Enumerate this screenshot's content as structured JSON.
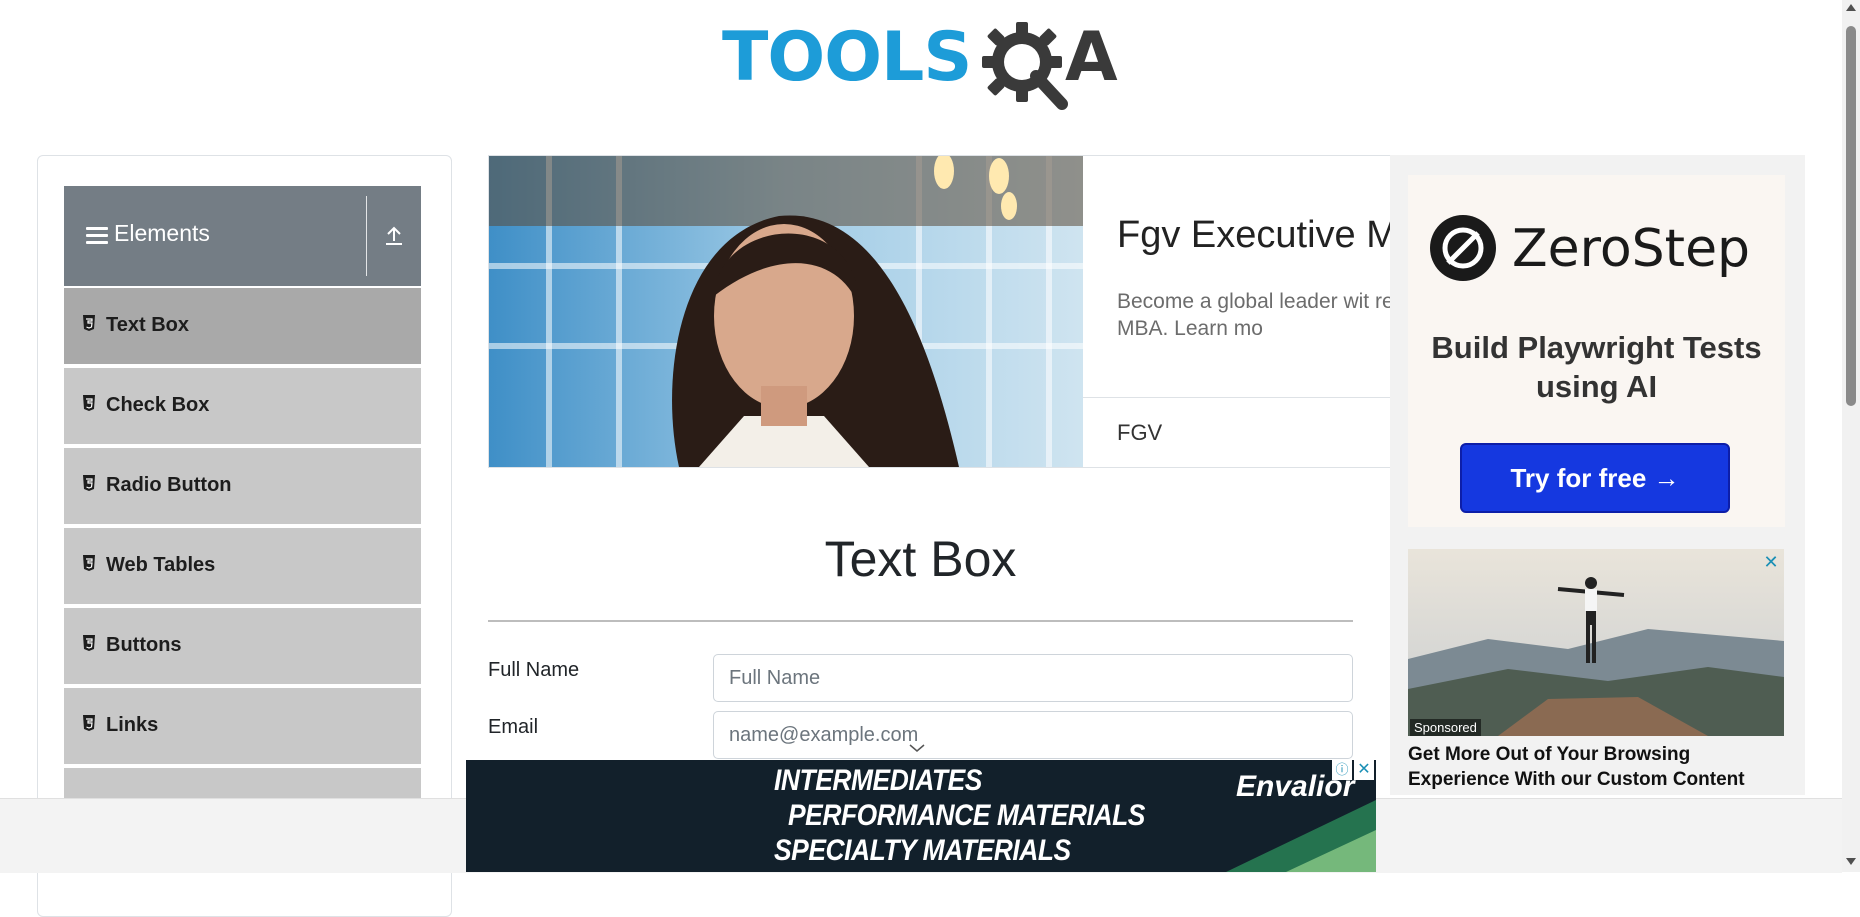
{
  "header": {
    "logo_text_left": "TOOLS",
    "logo_text_right": "A",
    "logo_alt": "TOOLSQA"
  },
  "sidebar": {
    "group_title": "Elements",
    "items": [
      {
        "label": "Text Box",
        "active": true
      },
      {
        "label": "Check Box"
      },
      {
        "label": "Radio Button"
      },
      {
        "label": "Web Tables"
      },
      {
        "label": "Buttons"
      },
      {
        "label": "Links"
      }
    ]
  },
  "top_ad": {
    "title": "Fgv Executive M",
    "description": "Become a global leader wit recognized MBA. Learn mo",
    "brand": "FGV"
  },
  "right_ad": {
    "brand": "ZeroStep",
    "headline": "Build Playwright Tests using AI",
    "cta": "Try for free →",
    "sponsored": "Sponsored",
    "promo_text": "Get More Out of Your Browsing Experience With our Custom Content",
    "close": "✕"
  },
  "main": {
    "title": "Text Box",
    "fields": [
      {
        "label": "Full Name",
        "placeholder": "Full Name"
      },
      {
        "label": "Email",
        "placeholder": "name@example.com"
      }
    ]
  },
  "bottom_ad": {
    "lines": [
      "INTERMEDIATES",
      "PERFORMANCE MATERIALS",
      "SPECIALTY MATERIALS"
    ],
    "brand": "Envalior",
    "close": "✕",
    "info": "ⓘ"
  },
  "colors": {
    "brand_blue": "#1d9cd8",
    "logo_dark": "#3a3a3a",
    "sidebar_header": "#747d85",
    "cta_blue": "#1538e0"
  }
}
